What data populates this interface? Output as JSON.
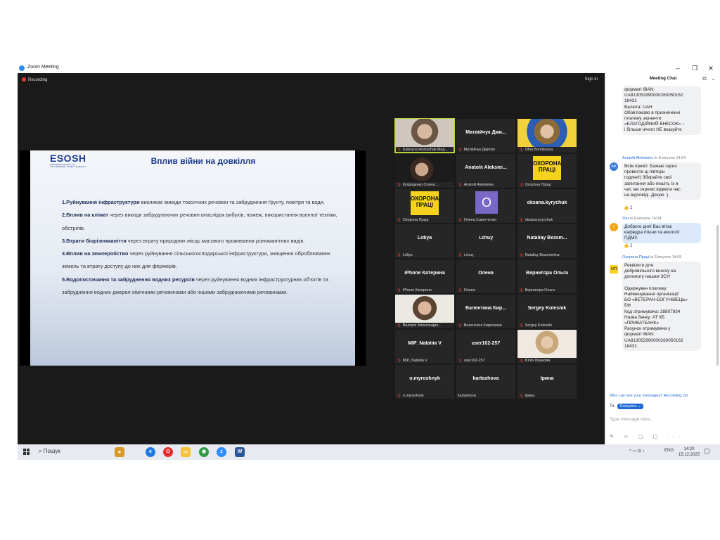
{
  "window": {
    "title": "Zoom Meeting",
    "minimize": "–",
    "restore": "❐",
    "close": "✕"
  },
  "meeting": {
    "recording_label": "Recording",
    "signin_label": "Sign in"
  },
  "slide": {
    "logo_text": "ESOSH",
    "logo_sub": "EUROPEAN SOCIETY OF OCCUPATIONAL SAFETY & HEALTH",
    "title": "Вплив війни на довкілля",
    "points": [
      {
        "bold": "1.Руйнування інфраструктури",
        "text": " викликає викиди токсичних речовин та забруднення ґрунту, повітря та води."
      },
      {
        "bold": "2.Вплив на клімат",
        "text": " через викиди забруднюючих речовин внаслідок вибухів, пожеж, використання воєнної техніки, обстрілів."
      },
      {
        "bold": "3.Втрати біорізноманіття",
        "text": " через втрату природних місць масового проживання різноманітних видів."
      },
      {
        "bold": "4.Вплив на землеробство",
        "text": " через руйнування сільськогосподарської інфраструктури, знищення оброблюваних земель та втрату доступу до них для фермерів."
      },
      {
        "bold": "5.Водопостачання та забруднення водних ресурсів",
        "text": " через руйнування водних інфраструктурних об'єктів та забруднення водних джерел хімічними речовинами або іншими забруднюючими речовинами."
      }
    ]
  },
  "gallery": [
    {
      "big": "",
      "label": "Kateryna Hnatyshak Мед...",
      "kind": "photo",
      "active": true
    },
    {
      "big": "Матвійчук Дми...",
      "label": "Матвійчук Дмитро",
      "kind": "name"
    },
    {
      "big": "",
      "label": "Olha Bohdanova",
      "kind": "photo2"
    },
    {
      "big": "",
      "label": "Купріщенко Олена ...",
      "kind": "photo3"
    },
    {
      "big": "Anatolii Aleksiei...",
      "label": "Anatolii Aleksieiev",
      "kind": "name"
    },
    {
      "big": "ОХОРОНА ПРАЦІ",
      "label": "Охорона Праці",
      "kind": "poster"
    },
    {
      "big": "ОХОРОНА ПРАЦІ",
      "label": "Охорона Праці",
      "kind": "poster"
    },
    {
      "big": "O",
      "label": "Олена Савотченко",
      "kind": "avatar"
    },
    {
      "big": "oksana.kyrychuk",
      "label": "oksana.kyrychuk",
      "kind": "name"
    },
    {
      "big": "Lidiya",
      "label": "Lidiya",
      "kind": "name"
    },
    {
      "big": "i.chuy",
      "label": "i.chuy",
      "kind": "name"
    },
    {
      "big": "Nataliay Bezsm...",
      "label": "Nataliay Bezsmertna",
      "kind": "name"
    },
    {
      "big": "iPhone Катерина",
      "label": "iPhone Катерина",
      "kind": "name"
    },
    {
      "big": "Олена",
      "label": "Олена",
      "kind": "name"
    },
    {
      "big": "Вернигора Ольга",
      "label": "Вернигора Ольга",
      "kind": "name"
    },
    {
      "big": "",
      "label": "Валерія Александро...",
      "kind": "photo4"
    },
    {
      "big": "Валентина Кир...",
      "label": "Валентина Кириченко",
      "kind": "name"
    },
    {
      "big": "Sergey Kolesnik",
      "label": "Sergey Kolesnik",
      "kind": "name"
    },
    {
      "big": "MIP_Nataliia V",
      "label": "MIP_Nataliia V",
      "kind": "name"
    },
    {
      "big": "user102-257",
      "label": "user102-257",
      "kind": "name"
    },
    {
      "big": "",
      "label": "Юлія Ляшкова",
      "kind": "photo5"
    },
    {
      "big": "o.myroshnyk",
      "label": "o.myroshnyk",
      "kind": "name"
    },
    {
      "big": "kartashova",
      "label": "kartashova",
      "kind": "name",
      "nomic": true
    },
    {
      "big": "Ірина",
      "label": "Ірина",
      "kind": "name"
    }
  ],
  "chat": {
    "title": "Meeting Chat",
    "msg1": [
      "форматі IBAN:",
      "UA813052990000260050162",
      "18431",
      "Валюта: UAH",
      "Обов'язково в призначенні",
      "платежу зазначте:",
      "«БЛАГОДІЙНИЙ ВНЕСОК» –",
      "і більше нічого НЕ вказуйте"
    ],
    "sender2": "Anatolii Aleksieiev",
    "to2": " to Everyone 14:04",
    "av2": "AA",
    "msg2": [
      "Всім привіт. Бажаю гарно",
      "провести ці півтори",
      "години!) Збирайте свої",
      "запитання або пишіть їх в",
      "чат, ми окремо відвели час",
      "на відповіді. Дякую :)"
    ],
    "react2": "👍 2",
    "sender3": "You",
    "to3": " to Everyone 14:04",
    "av3": "I",
    "msg3": [
      "Доброго дня! Вас вітає",
      "кафедра гігієни та екології",
      "ПДМУ."
    ],
    "react3": "👍 2",
    "sender4": "Охорона Праці",
    "to4": " to Everyone 14:05",
    "msg4": [
      "Реквізити для",
      "добровільного внеску на",
      "допомогу нашим ЗСУ!",
      "",
      "Одержувач платежу:",
      "Найменування організації:",
      "БО «ВЕТЕРАН-БОГУНІВЕЦЬ»",
      "БФ",
      "Код отримувача: 38807934",
      "Назва банку: АТ КБ",
      "«ПРИВАТБАНК»",
      "Рахунок отримувача у",
      "форматі IBAN:",
      "UA813052990000260050162",
      "18431"
    ],
    "who_can_see": "Who can see your messages? Recording On",
    "to_label": "To:",
    "to_value": "Everyone ⌄",
    "placeholder": "Type message here...",
    "tools": "✎ ☺ ▢ ▢ ···"
  },
  "taskbar": {
    "search_label": "Пошук",
    "lang": "ENG",
    "time": "14:20",
    "date": "15.12.2025"
  }
}
